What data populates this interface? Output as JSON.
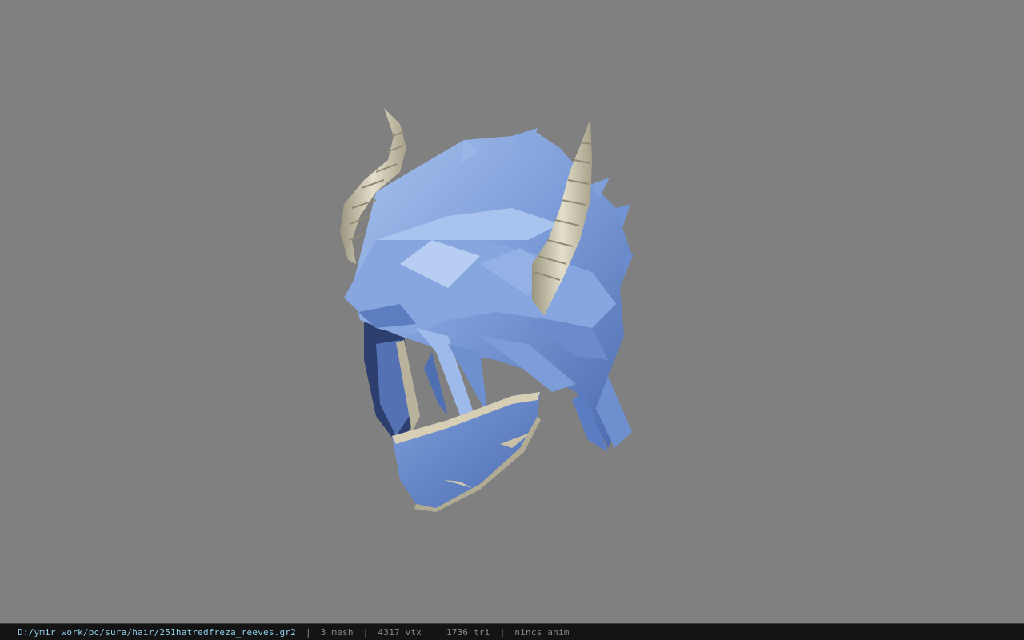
{
  "viewport": {
    "background_color": "#808080",
    "model_name": "hair-helmet-model"
  },
  "status": {
    "path": "D:/ymir work/pc/sura/hair/251hatredfreza_reeves.gr2",
    "separator": "|",
    "mesh": "3 mesh",
    "vtx": "4317 vtx",
    "tri": "1736 tri",
    "anim": "nincs anim"
  },
  "colors": {
    "hair_light": "#9db8e6",
    "hair_mid": "#6f90cf",
    "hair_dark": "#3f5d9e",
    "horn": "#d8d2bc",
    "horn_dark": "#8f8a76",
    "status_path": "#8fd0ea",
    "status_text": "#8a8a8a"
  }
}
